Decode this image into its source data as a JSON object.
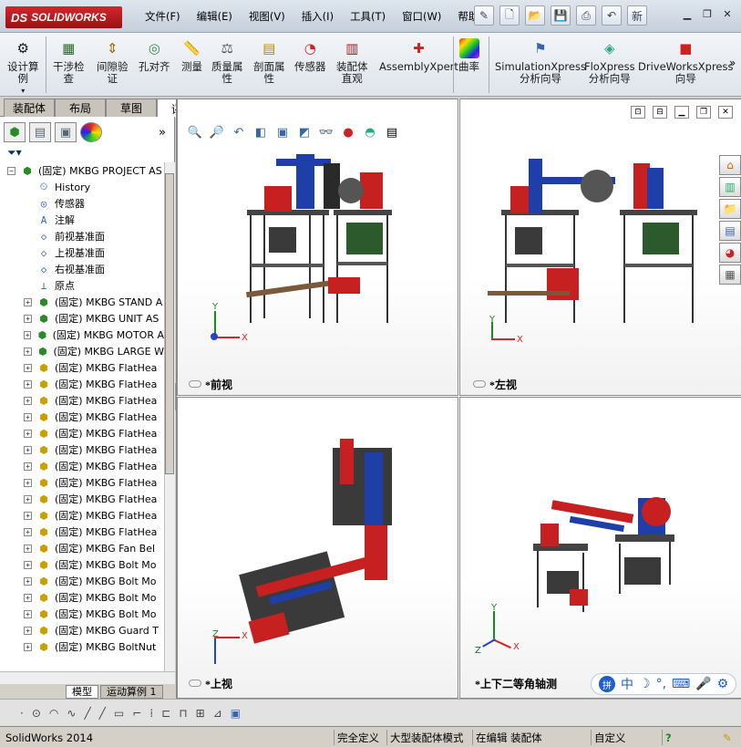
{
  "app": {
    "logo": "SOLIDWORKS",
    "logo_mark": "DS",
    "status_app": "SolidWorks 2014"
  },
  "menus": [
    "文件(F)",
    "编辑(E)",
    "视图(V)",
    "插入(I)",
    "工具(T)",
    "窗口(W)",
    "帮助(H)"
  ],
  "quick_access": {
    "extra": "新"
  },
  "ribbon": [
    {
      "label": "设计算\n例",
      "icon": "design-study-icon"
    },
    {
      "label": "干涉检\n查",
      "icon": "interference-check-icon"
    },
    {
      "label": "间隙验\n证",
      "icon": "clearance-icon"
    },
    {
      "label": "孔对齐",
      "icon": "hole-align-icon"
    },
    {
      "label": "测量",
      "icon": "measure-icon"
    },
    {
      "label": "质量属\n性",
      "icon": "mass-properties-icon"
    },
    {
      "label": "剖面属\n性",
      "icon": "section-properties-icon"
    },
    {
      "label": "传感器",
      "icon": "sensor-icon"
    },
    {
      "label": "装配体\n直观",
      "icon": "assembly-visualization-icon"
    },
    {
      "label": "AssemblyXpert",
      "icon": "assemblyxpert-icon"
    },
    {
      "label": "曲率",
      "icon": "curvature-icon"
    },
    {
      "label": "SimulationXpress\n分析向导",
      "icon": "simulationxpress-icon"
    },
    {
      "label": "FloXpress\n分析向导",
      "icon": "floxpress-icon"
    },
    {
      "label": "DriveWorksXpress\n向导",
      "icon": "driveworks-icon"
    }
  ],
  "tabs": [
    "装配体",
    "布局",
    "草图",
    "评估"
  ],
  "active_tab": "评估",
  "tree": {
    "root": "(固定) MKBG PROJECT AS",
    "special": [
      "History",
      "传感器",
      "注解",
      "前视基准面",
      "上视基准面",
      "右视基准面",
      "原点"
    ],
    "components": [
      "(固定) MKBG STAND A",
      "(固定) MKBG UNIT AS",
      "(固定) MKBG MOTOR A",
      "(固定) MKBG LARGE W",
      "(固定) MKBG FlatHea",
      "(固定) MKBG FlatHea",
      "(固定) MKBG FlatHea",
      "(固定) MKBG FlatHea",
      "(固定) MKBG FlatHea",
      "(固定) MKBG FlatHea",
      "(固定) MKBG FlatHea",
      "(固定) MKBG FlatHea",
      "(固定) MKBG FlatHea",
      "(固定) MKBG FlatHea",
      "(固定) MKBG FlatHea",
      "(固定) MKBG Fan Bel",
      "(固定) MKBG Bolt Mo",
      "(固定) MKBG Bolt Mo",
      "(固定) MKBG Bolt Mo",
      "(固定) MKBG Bolt Mo",
      "(固定) MKBG Guard T",
      "(固定) MKBG BoltNut"
    ]
  },
  "bottom_tabs": [
    "模型",
    "运动算例 1"
  ],
  "viewports": [
    "*前视",
    "*左视",
    "*上视",
    "*上下二等角轴测"
  ],
  "axis": {
    "x": "X",
    "y": "Y",
    "z": "Z"
  },
  "ime": {
    "lang": "中"
  },
  "status": {
    "defined": "完全定义",
    "mode": "大型装配体模式",
    "editing": "在编辑 装配体",
    "custom": "自定义",
    "help": "?"
  },
  "colors": {
    "brand": "#c1181d",
    "part_blue": "#1e3fa8",
    "part_red": "#c62020"
  }
}
